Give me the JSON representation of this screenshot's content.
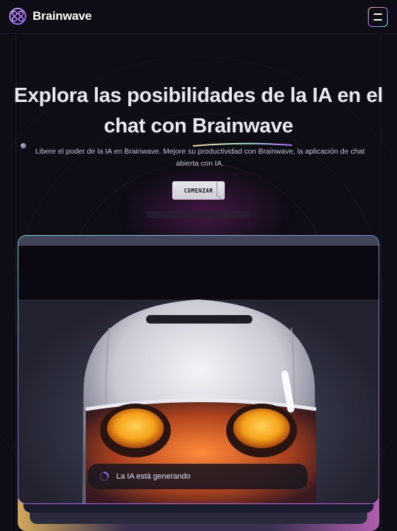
{
  "header": {
    "logo_text": "Brainwave",
    "logo_icon": "brain-icon",
    "menu_icon": "hamburger-icon"
  },
  "hero": {
    "title_part1": "Explora las posibilidades de la IA  en el chat con",
    "title_highlight": "Brainwave",
    "subtitle": "Libere el poder de la IA en Brainwave. Mejore su productividad con Brainwave, la aplicación de chat abierta con IA.",
    "cta_label": "COMENZAR"
  },
  "showcase": {
    "status_text": "La IA está generando",
    "status_icon": "loading-spinner-icon"
  },
  "colors": {
    "background": "#0e0c15",
    "accent_gradient": [
      "#f9d99a",
      "#ac6aff",
      "#79fff7"
    ],
    "text": "#fefefe"
  }
}
